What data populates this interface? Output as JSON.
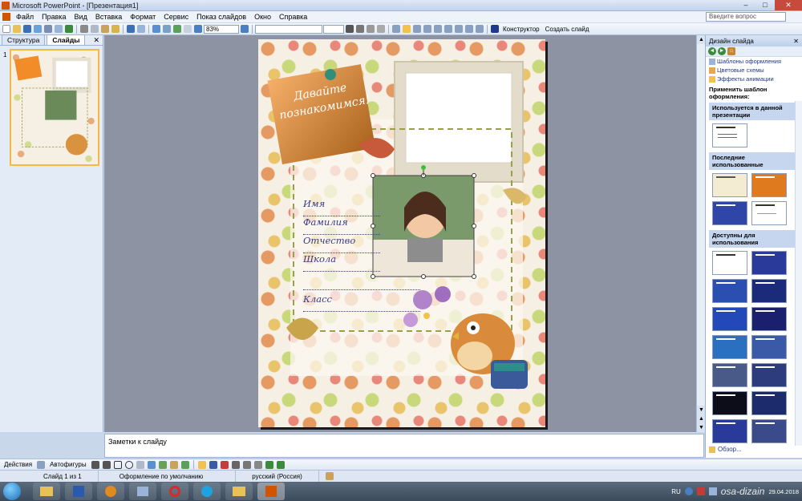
{
  "window": {
    "title": "Microsoft PowerPoint - [Презентация1]",
    "minimize": "–",
    "maximize": "□",
    "close": "✕"
  },
  "menu": {
    "items": [
      "Файл",
      "Правка",
      "Вид",
      "Вставка",
      "Формат",
      "Сервис",
      "Показ слайдов",
      "Окно",
      "Справка"
    ],
    "help_placeholder": "Введите вопрос"
  },
  "toolbar": {
    "zoom": "83%",
    "font_value": "",
    "size_value": "",
    "designer": "Конструктор",
    "new_slide": "Создать слайд"
  },
  "left_panel": {
    "tabs": [
      {
        "label": "Структура"
      },
      {
        "label": "Слайды"
      }
    ],
    "close": "✕",
    "slide_number": "1"
  },
  "slide": {
    "sticker_text": "Давайте познакомимся!",
    "fields": [
      "Имя",
      "Фамилия",
      "Отчество",
      "Школа",
      "",
      "Класс"
    ]
  },
  "notes": {
    "placeholder": "Заметки к слайду"
  },
  "task_pane": {
    "title": "Дизайн слайда",
    "close": "✕",
    "links": [
      "Шаблоны оформления",
      "Цветовые схемы",
      "Эффекты анимации"
    ],
    "apply_label": "Применить шаблон оформления:",
    "sections": [
      {
        "label": "Используется в данной презентации"
      },
      {
        "label": "Последние использованные"
      },
      {
        "label": "Доступны для использования"
      }
    ],
    "browse": "Обзор..."
  },
  "drawing_toolbar": {
    "actions": "Действия",
    "autoshapes": "Автофигуры"
  },
  "status": {
    "slide": "Слайд 1 из 1",
    "design": "Оформление по умолчанию",
    "language": "русский (Россия)"
  },
  "taskbar": {
    "lang": "RU",
    "date": "29.04.2018",
    "watermark": "osa-dizain"
  },
  "colors": {
    "accent": "#f28c28",
    "title_bar": "#c3d3ec",
    "slide_dot_orange": "#e59a64",
    "slide_dot_green": "#c9d87a"
  }
}
